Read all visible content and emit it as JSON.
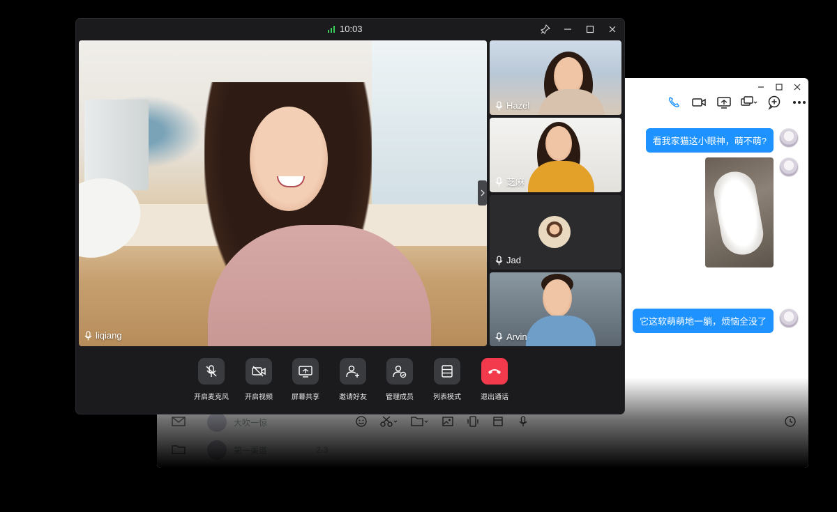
{
  "call": {
    "time": "10:03",
    "main_participant": "liqiang",
    "participants": [
      {
        "name": "Hazel"
      },
      {
        "name": "芝麻"
      },
      {
        "name": "Jad"
      },
      {
        "name": "Arvin"
      }
    ],
    "controls": [
      {
        "label": "开启麦克风",
        "icon": "mic-off-icon"
      },
      {
        "label": "开启视频",
        "icon": "video-off-icon"
      },
      {
        "label": "屏幕共享",
        "icon": "screen-share-icon"
      },
      {
        "label": "邀请好友",
        "icon": "invite-user-icon"
      },
      {
        "label": "管理成员",
        "icon": "manage-members-icon"
      },
      {
        "label": "列表模式",
        "icon": "list-mode-icon"
      },
      {
        "label": "退出通话",
        "icon": "hang-up-icon"
      }
    ],
    "colors": {
      "hangup": "#f23a4c",
      "signal": "#3ecf5a",
      "bubble": "#1e92ff"
    }
  },
  "chat": {
    "messages": [
      {
        "type": "text",
        "text": "看我家猫这小眼神，萌不萌?"
      },
      {
        "type": "image",
        "description": "cat"
      },
      {
        "type": "text",
        "text": "它这软萌萌地一躺，烦恼全没了"
      }
    ],
    "contacts": [
      {
        "name": "大吹一惊"
      },
      {
        "name": "第一渠道",
        "meta": "2-3"
      }
    ]
  }
}
